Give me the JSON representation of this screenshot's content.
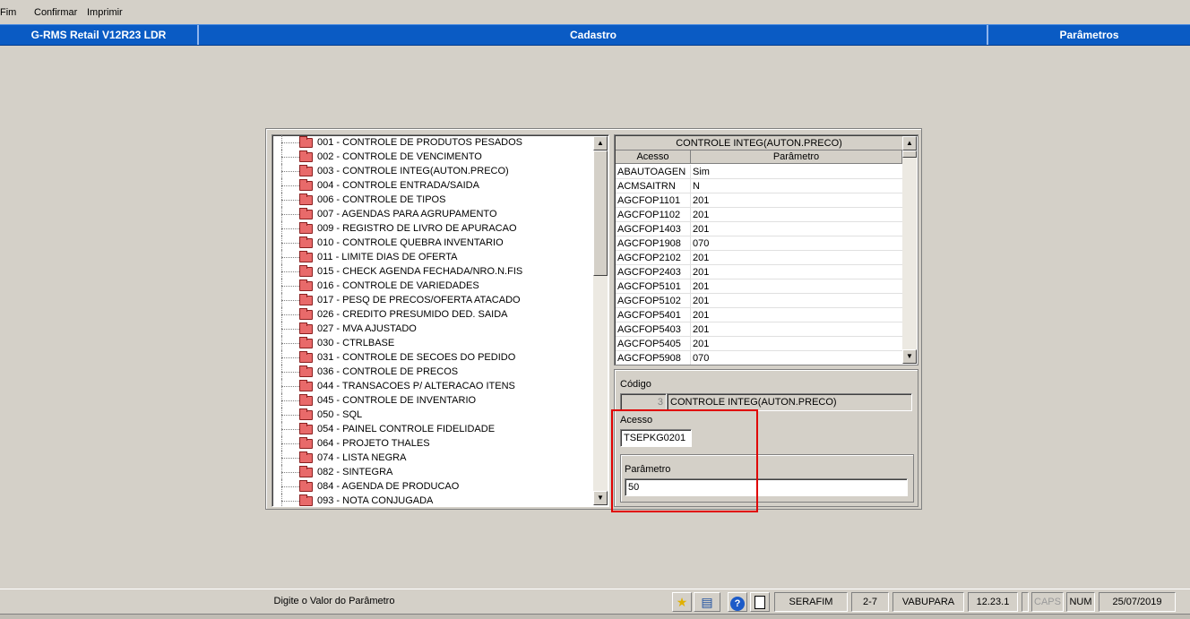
{
  "menu": {
    "items": [
      "Fim",
      "Confirmar",
      "Imprimir"
    ]
  },
  "titlebar": {
    "app": "G-RMS Retail V12R23 LDR",
    "module": "Cadastro",
    "screen": "Parâmetros"
  },
  "tree": {
    "items": [
      "001 - CONTROLE DE PRODUTOS PESADOS",
      "002 - CONTROLE DE VENCIMENTO",
      "003 - CONTROLE INTEG(AUTON.PRECO)",
      "004 - CONTROLE ENTRADA/SAIDA",
      "006 - CONTROLE DE TIPOS",
      "007 - AGENDAS PARA AGRUPAMENTO",
      "009 - REGISTRO DE LIVRO DE APURACAO",
      "010 - CONTROLE QUEBRA INVENTARIO",
      "011 - LIMITE DIAS DE OFERTA",
      "015 - CHECK AGENDA FECHADA/NRO.N.FIS",
      "016 - CONTROLE DE VARIEDADES",
      "017 - PESQ DE PRECOS/OFERTA ATACADO",
      "026 - CREDITO PRESUMIDO DED. SAIDA",
      "027 - MVA AJUSTADO",
      "030 - CTRLBASE",
      "031 - CONTROLE DE SECOES DO PEDIDO",
      "036 - CONTROLE DE PRECOS",
      "044 - TRANSACOES P/ ALTERACAO ITENS",
      "045 - CONTROLE DE INVENTARIO",
      "050 - SQL",
      "054 - PAINEL CONTROLE FIDELIDADE",
      "064 - PROJETO THALES",
      "074 - LISTA NEGRA",
      "082 - SINTEGRA",
      "084 - AGENDA DE PRODUCAO",
      "093 - NOTA CONJUGADA"
    ]
  },
  "grid": {
    "title": "CONTROLE INTEG(AUTON.PRECO)",
    "headers": {
      "acesso": "Acesso",
      "parametro": "Parâmetro"
    },
    "rows": [
      {
        "acesso": "ABAUTOAGEN",
        "parametro": "Sim"
      },
      {
        "acesso": "ACMSAITRN",
        "parametro": "N"
      },
      {
        "acesso": "AGCFOP1101",
        "parametro": "201"
      },
      {
        "acesso": "AGCFOP1102",
        "parametro": "201"
      },
      {
        "acesso": "AGCFOP1403",
        "parametro": "201"
      },
      {
        "acesso": "AGCFOP1908",
        "parametro": "070"
      },
      {
        "acesso": "AGCFOP2102",
        "parametro": "201"
      },
      {
        "acesso": "AGCFOP2403",
        "parametro": "201"
      },
      {
        "acesso": "AGCFOP5101",
        "parametro": "201"
      },
      {
        "acesso": "AGCFOP5102",
        "parametro": "201"
      },
      {
        "acesso": "AGCFOP5401",
        "parametro": "201"
      },
      {
        "acesso": "AGCFOP5403",
        "parametro": "201"
      },
      {
        "acesso": "AGCFOP5405",
        "parametro": "201"
      },
      {
        "acesso": "AGCFOP5908",
        "parametro": "070"
      }
    ]
  },
  "form": {
    "codigo_label": "Código",
    "codigo_value": "3",
    "codigo_desc": "CONTROLE INTEG(AUTON.PRECO)",
    "acesso_label": "Acesso",
    "acesso_value": "TSEPKG0201",
    "parametro_label": "Parâmetro",
    "parametro_value": "50"
  },
  "status": {
    "message": "Digite o Valor do Parâmetro",
    "user": "SERAFIM",
    "code": "2-7",
    "company": "VABUPARA",
    "version": "12.23.1",
    "caps": "CAPS",
    "num": "NUM",
    "date": "25/07/2019"
  },
  "icons": {
    "favorite": "star-icon",
    "users": "user-list-icon",
    "help": "help-icon",
    "clipboard": "clipboard-icon"
  },
  "colors": {
    "titlebar": "#0a5bc4",
    "highlight": "#e00000",
    "background": "#d4d0c8"
  }
}
